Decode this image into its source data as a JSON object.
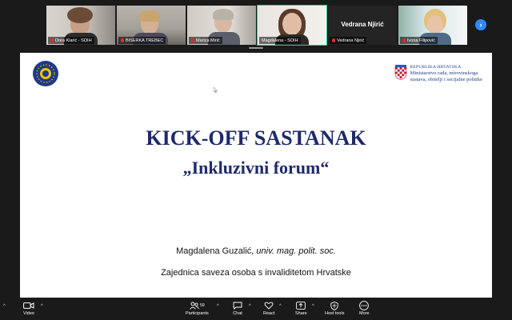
{
  "participants": [
    {
      "name": "Dora Klarić - SOIH",
      "muted": true
    },
    {
      "name": "BISERKA TREBEC",
      "muted": true
    },
    {
      "name": "Marica Mirić",
      "muted": true
    },
    {
      "name": "Magdalena - SOIH",
      "muted": false,
      "active": true
    },
    {
      "name": "Vedrana Njirić",
      "muted": true,
      "big_name": "Vedrana Njirić"
    },
    {
      "name": "Ivona Filipović",
      "muted": true
    }
  ],
  "slide": {
    "ministry_line1": "REPUBLIKA HRVATSKA",
    "ministry_line2": "Ministarstvo rada, mirovinskoga",
    "ministry_line3": "sustava, obitelji i socijalne politike",
    "title": "KICK-OFF SASTANAK",
    "subtitle": "„Inkluzivni forum“",
    "presenter_name": "Magdalena Guzalić,",
    "presenter_title": "univ. mag. polit. soc.",
    "organization": "Zajednica saveza osoba s invaliditetom Hrvatske"
  },
  "toolbar": {
    "video_label": "Video",
    "participants_label": "Participants",
    "participants_count": "59",
    "chat_label": "Chat",
    "react_label": "React",
    "share_label": "Share",
    "host_tools_label": "Host tools",
    "more_label": "More"
  },
  "colors": {
    "active_speaker": "#23d18b",
    "accent_blue": "#2d8cff",
    "slide_title": "#1e2a6b",
    "muted_red": "#e02828"
  }
}
